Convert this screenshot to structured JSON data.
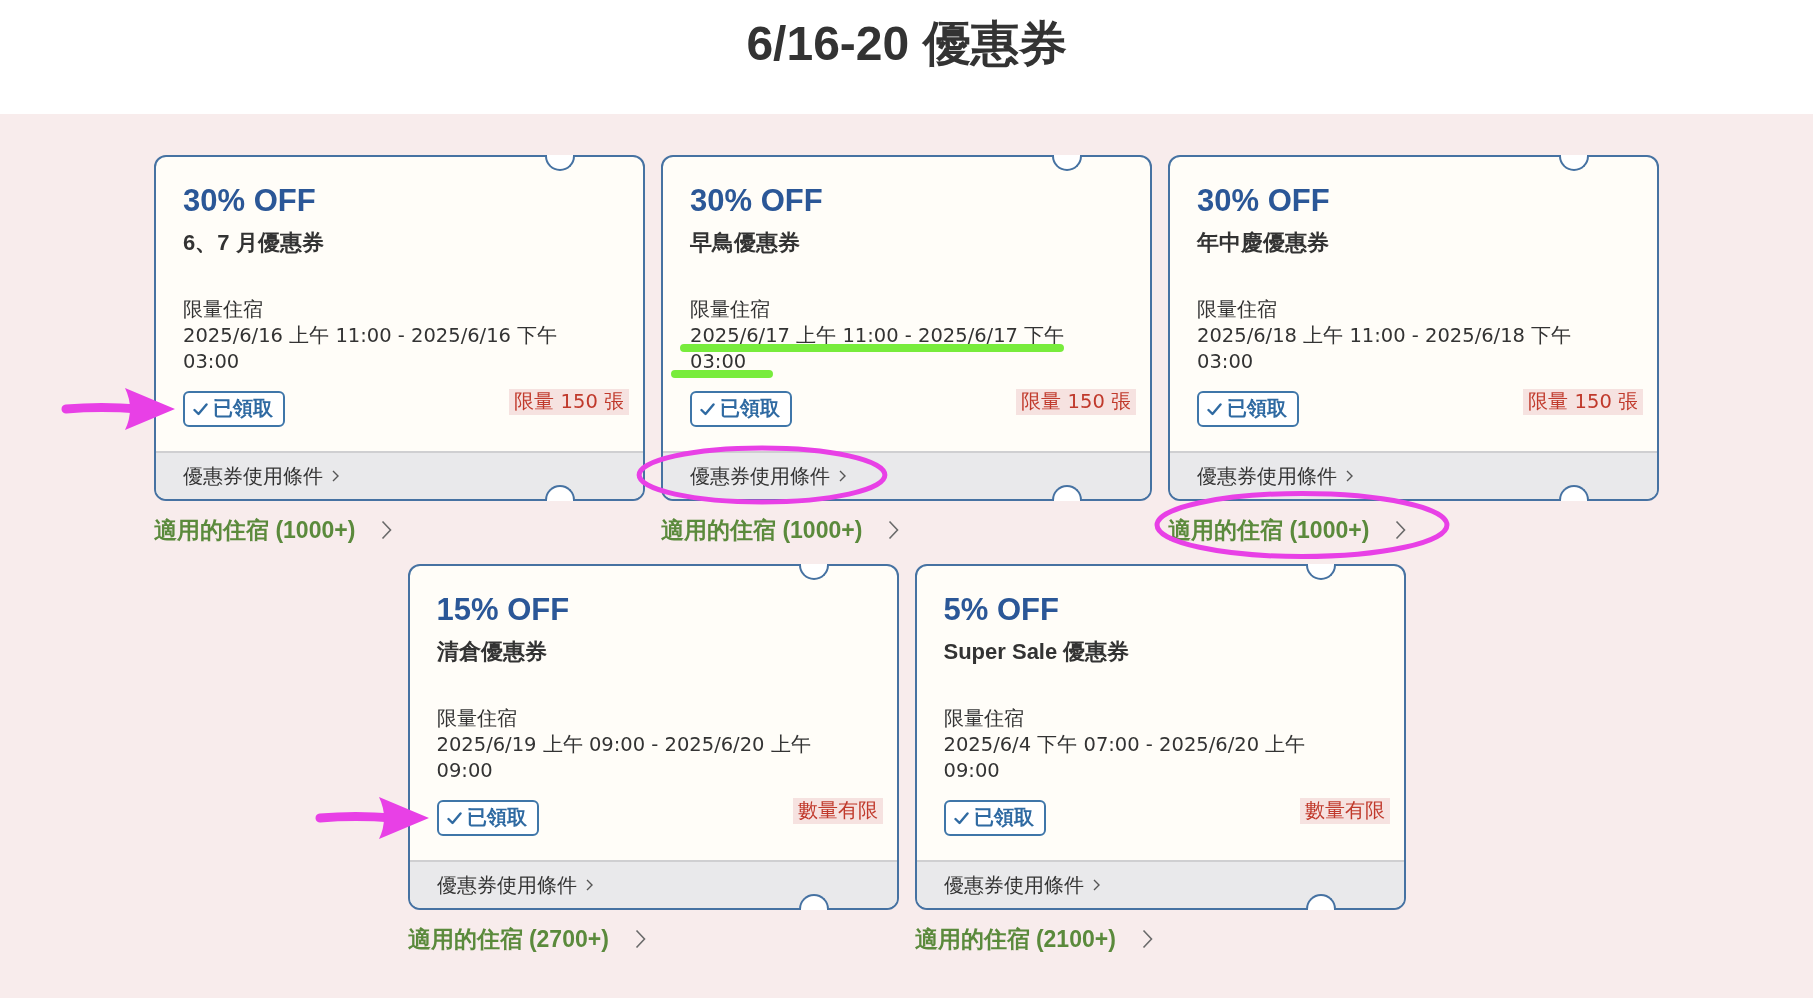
{
  "page": {
    "title": "6/16-20 優惠券"
  },
  "coupons": [
    {
      "discount": "30% OFF",
      "name": "6、7 月優惠券",
      "scope": "限量住宿",
      "period": {
        "text": "2025/6/16 上午 11:00 - 2025/6/16 下午 03:00"
      },
      "claim_button": {
        "label": "已領取",
        "claimed": true,
        "annotations": [
          {
            "kind": "arrow",
            "color": "#e840e6"
          }
        ]
      },
      "quantity_tag": "限量 150 張",
      "terms_link": {
        "label": "優惠券使用條件"
      },
      "hotels_link": {
        "label": "適用的住宿 (1000+)"
      }
    },
    {
      "discount": "30% OFF",
      "name": "早鳥優惠券",
      "scope": "限量住宿",
      "period": {
        "text": "2025/6/17 上午 11:00 - 2025/6/17 下午 03:00",
        "annotations": [
          {
            "kind": "underline",
            "color": "#78ec3c"
          }
        ]
      },
      "claim_button": {
        "label": "已領取",
        "claimed": true
      },
      "quantity_tag": "限量 150 張",
      "terms_link": {
        "label": "優惠券使用條件",
        "annotations": [
          {
            "kind": "ellipse",
            "color": "#e840e6"
          }
        ]
      },
      "hotels_link": {
        "label": "適用的住宿 (1000+)"
      }
    },
    {
      "discount": "30% OFF",
      "name": "年中慶優惠券",
      "scope": "限量住宿",
      "period": {
        "text": "2025/6/18 上午 11:00 - 2025/6/18 下午 03:00"
      },
      "claim_button": {
        "label": "已領取",
        "claimed": true
      },
      "quantity_tag": "限量 150 張",
      "terms_link": {
        "label": "優惠券使用條件"
      },
      "hotels_link": {
        "label": "適用的住宿 (1000+)",
        "annotations": [
          {
            "kind": "ellipse",
            "color": "#e840e6"
          }
        ]
      }
    },
    {
      "discount": "15% OFF",
      "name": "清倉優惠券",
      "scope": "限量住宿",
      "period": {
        "text": "2025/6/19 上午 09:00 - 2025/6/20 上午 09:00"
      },
      "claim_button": {
        "label": "已領取",
        "claimed": true,
        "annotations": [
          {
            "kind": "arrow",
            "color": "#e840e6"
          }
        ]
      },
      "quantity_tag": "數量有限",
      "terms_link": {
        "label": "優惠券使用條件"
      },
      "hotels_link": {
        "label": "適用的住宿 (2700+)"
      }
    },
    {
      "discount": "5% OFF",
      "name": "Super Sale 優惠券",
      "scope": "限量住宿",
      "period": {
        "text": "2025/6/4 下午 07:00 - 2025/6/20 上午 09:00"
      },
      "claim_button": {
        "label": "已領取",
        "claimed": true
      },
      "quantity_tag": "數量有限",
      "terms_link": {
        "label": "優惠券使用條件"
      },
      "hotels_link": {
        "label": "適用的住宿 (2100+)"
      }
    }
  ]
}
